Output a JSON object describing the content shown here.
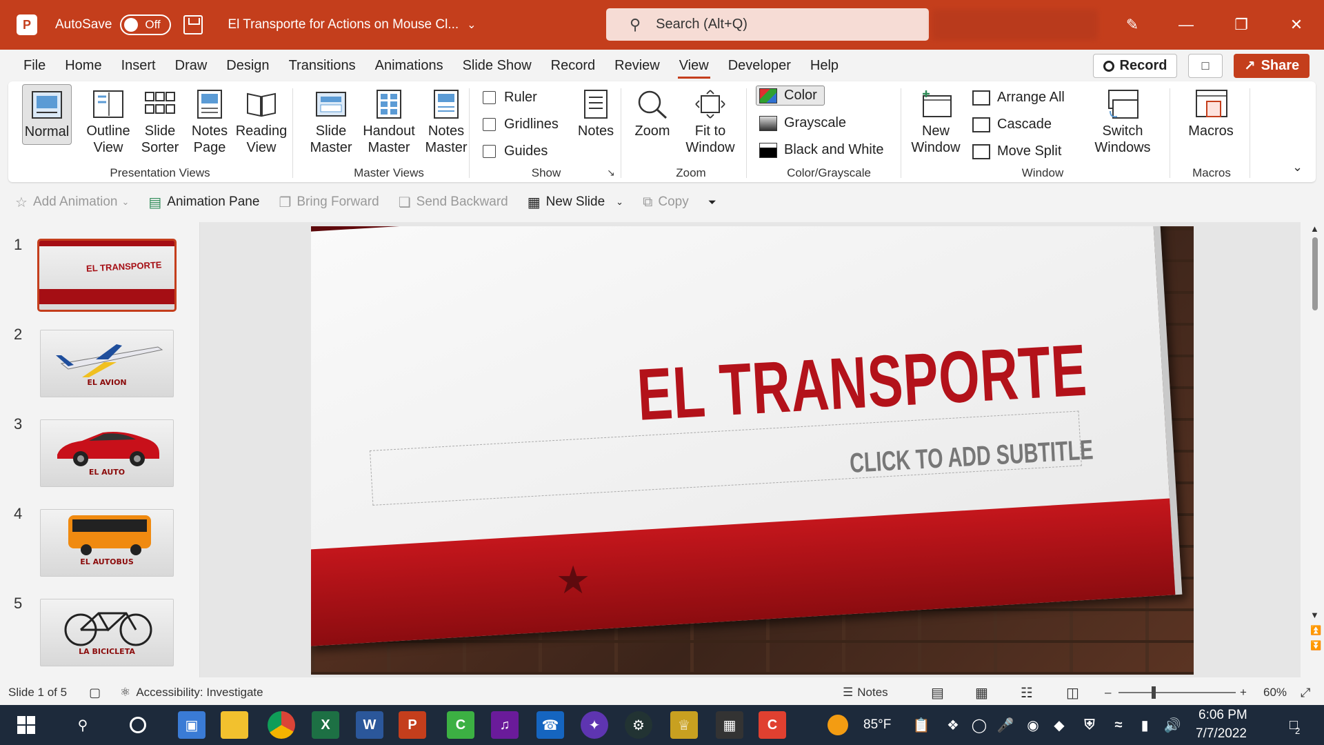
{
  "titlebar": {
    "app_initial": "P",
    "autosave_label": "AutoSave",
    "autosave_state": "Off",
    "doc_title": "El Transporte for Actions on Mouse Cl...",
    "search_placeholder": "Search (Alt+Q)"
  },
  "menu": {
    "tabs": [
      "File",
      "Home",
      "Insert",
      "Draw",
      "Design",
      "Transitions",
      "Animations",
      "Slide Show",
      "Record",
      "Review",
      "View",
      "Developer",
      "Help"
    ],
    "active_tab": "View",
    "record_label": "Record",
    "share_label": "Share"
  },
  "ribbon": {
    "presentation_views": {
      "label": "Presentation Views",
      "normal": "Normal",
      "outline": [
        "Outline",
        "View"
      ],
      "sorter": [
        "Slide",
        "Sorter"
      ],
      "notes_page": [
        "Notes",
        "Page"
      ],
      "reading": [
        "Reading",
        "View"
      ]
    },
    "master_views": {
      "label": "Master Views",
      "slide_master": [
        "Slide",
        "Master"
      ],
      "handout_master": [
        "Handout",
        "Master"
      ],
      "notes_master": [
        "Notes",
        "Master"
      ]
    },
    "show": {
      "label": "Show",
      "ruler": "Ruler",
      "gridlines": "Gridlines",
      "guides": "Guides",
      "notes": "Notes"
    },
    "zoom": {
      "label": "Zoom",
      "zoom": "Zoom",
      "fit": [
        "Fit to",
        "Window"
      ]
    },
    "color": {
      "label": "Color/Grayscale",
      "color": "Color",
      "grayscale": "Grayscale",
      "bw": "Black and White"
    },
    "window": {
      "label": "Window",
      "new_window": [
        "New",
        "Window"
      ],
      "arrange_all": "Arrange All",
      "cascade": "Cascade",
      "move_split": "Move Split",
      "switch": [
        "Switch",
        "Windows"
      ]
    },
    "macros": {
      "label": "Macros",
      "macros": "Macros"
    }
  },
  "qat": {
    "add_animation": "Add Animation",
    "animation_pane": "Animation Pane",
    "bring_forward": "Bring Forward",
    "send_backward": "Send Backward",
    "new_slide": "New Slide",
    "copy": "Copy"
  },
  "slides": [
    {
      "num": "1",
      "label": "EL TRANSPORTE"
    },
    {
      "num": "2",
      "label": "EL AVION"
    },
    {
      "num": "3",
      "label": "EL AUTO"
    },
    {
      "num": "4",
      "label": "EL AUTOBUS"
    },
    {
      "num": "5",
      "label": "LA BICICLETA"
    }
  ],
  "current_slide": {
    "title": "EL TRANSPORTE",
    "subtitle": "CLICK TO ADD SUBTITLE"
  },
  "status": {
    "slide_info": "Slide 1 of 5",
    "accessibility": "Accessibility: Investigate",
    "notes": "Notes",
    "zoom": "60%"
  },
  "taskbar": {
    "weather": "85°F",
    "time": "6:06 PM",
    "date": "7/7/2022",
    "notif_count": "2"
  },
  "colors": {
    "accent": "#c43e1c",
    "slide_red": "#b3121a"
  }
}
